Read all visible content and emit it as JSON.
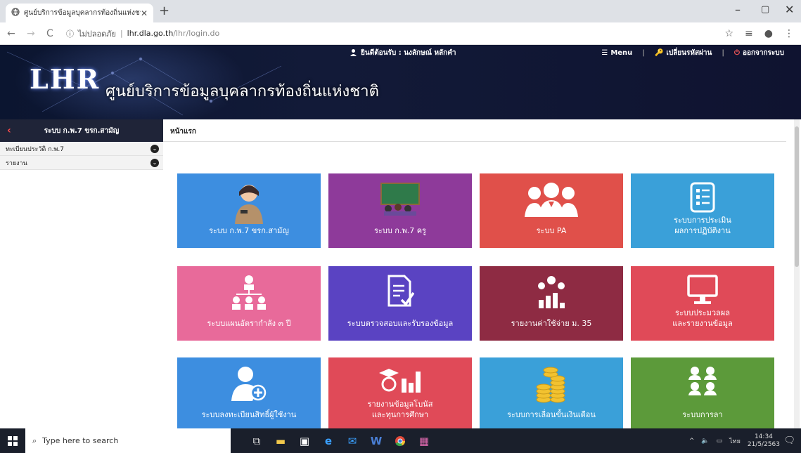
{
  "browser": {
    "tab_title": "ศูนย์บริการข้อมูลบุคลากรท้องถิ่นแห่งชาติ",
    "address_security": "ไม่ปลอดภัย",
    "address_host": "lhr.dla.go.th",
    "address_path": "/lhr/login.do"
  },
  "header": {
    "logo_text": "LHR",
    "site_title": "ศูนย์บริการข้อมูลบุคลากรท้องถิ่นแห่งชาติ",
    "welcome": "ยินดีต้อนรับ : นงลักษณ์ หลักคำ",
    "menu_label": "Menu",
    "change_password_label": "เปลี่ยนรหัสผ่าน",
    "logout_label": "ออกจากระบบ"
  },
  "sidebar": {
    "title": "ระบบ ก.พ.7 ขรก.สามัญ",
    "items": [
      {
        "label": "ทะเบียนประวัติ ก.พ.7"
      },
      {
        "label": "รายงาน"
      }
    ]
  },
  "main": {
    "breadcrumb": "หน้าแรก",
    "tiles": [
      {
        "label": "ระบบ ก.พ.7 ขรก.สามัญ",
        "color": "#3d8ee0",
        "icon": "officer-icon"
      },
      {
        "label": "ระบบ ก.พ.7 ครู",
        "color": "#8e3a9a",
        "icon": "classroom-icon"
      },
      {
        "label": "ระบบ PA",
        "color": "#e0504a",
        "icon": "group-icon"
      },
      {
        "label": "ระบบการประเมิน\nผลการปฏิบัติงาน",
        "color": "#3aa0d9",
        "icon": "checklist-icon"
      },
      {
        "label": "ระบบแผนอัตรากำลัง ๓ ปี",
        "color": "#e86a9a",
        "icon": "org-chart-icon"
      },
      {
        "label": "ระบบตรวจสอบและรับรองข้อมูล",
        "color": "#5a43c2",
        "icon": "document-check-icon"
      },
      {
        "label": "รายงานค่าใช้จ่าย ม. 35",
        "color": "#8e2b43",
        "icon": "money-chart-icon"
      },
      {
        "label": "ระบบประมวลผล\nและรายงานข้อมูล",
        "color": "#e04a58",
        "icon": "monitor-icon"
      },
      {
        "label": "ระบบลงทะเบียนสิทธิ์ผู้ใช้งาน",
        "color": "#3d8ee0",
        "icon": "add-user-icon"
      },
      {
        "label": "รายงานข้อมูลโบนัส\nและทุนการศึกษา",
        "color": "#e04a58",
        "icon": "bonus-report-icon"
      },
      {
        "label": "ระบบการเลื่อนขั้นเงินเดือน",
        "color": "#3aa0d9",
        "icon": "coins-icon"
      },
      {
        "label": "ระบบการลา",
        "color": "#5c9a3a",
        "icon": "people-icon"
      }
    ]
  },
  "taskbar": {
    "search_placeholder": "Type here to search",
    "time": "14:34",
    "date": "21/5/2563"
  }
}
